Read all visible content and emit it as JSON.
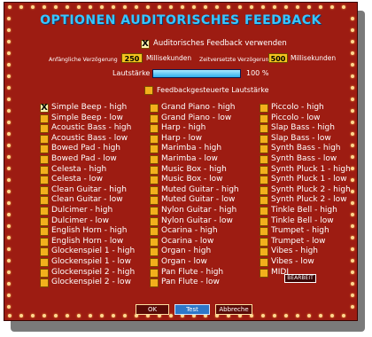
{
  "title": "OPTIONEN AUDITORISCHES FEEDBACK",
  "use_feedback": {
    "label": "Auditorisches Feedback verwenden",
    "checked": true
  },
  "initial_delay": {
    "label": "Anfängliche Verzögerung",
    "value": "250",
    "unit": "Millisekunden"
  },
  "staggered_delay": {
    "label": "Zeitversetzte Verzögerung",
    "value": "500",
    "unit": "Millisekunden"
  },
  "volume": {
    "label": "Lautstärke",
    "value_text": "100 %",
    "level": 1.0
  },
  "feedback_volume": {
    "label": "Feedbackgesteuerte Lautstärke",
    "checked": false
  },
  "sounds": {
    "col1": [
      {
        "label": "Simple Beep - high",
        "checked": true
      },
      {
        "label": "Simple Beep - low",
        "checked": false
      },
      {
        "label": "Acoustic Bass - high",
        "checked": false
      },
      {
        "label": "Acoustic Bass - low",
        "checked": false
      },
      {
        "label": "Bowed Pad - high",
        "checked": false
      },
      {
        "label": "Bowed Pad - low",
        "checked": false
      },
      {
        "label": "Celesta - high",
        "checked": false
      },
      {
        "label": "Celesta - low",
        "checked": false
      },
      {
        "label": "Clean Guitar - high",
        "checked": false
      },
      {
        "label": "Clean Guitar - low",
        "checked": false
      },
      {
        "label": "Dulcimer - high",
        "checked": false
      },
      {
        "label": "Dulcimer - low",
        "checked": false
      },
      {
        "label": "English Horn - high",
        "checked": false
      },
      {
        "label": "English Horn - low",
        "checked": false
      },
      {
        "label": "Glockenspiel 1 - high",
        "checked": false
      },
      {
        "label": "Glockenspiel 1 - low",
        "checked": false
      },
      {
        "label": "Glockenspiel 2 - high",
        "checked": false
      },
      {
        "label": "Glockenspiel 2 - low",
        "checked": false
      }
    ],
    "col2": [
      {
        "label": "Grand Piano - high",
        "checked": false
      },
      {
        "label": "Grand Piano - low",
        "checked": false
      },
      {
        "label": "Harp - high",
        "checked": false
      },
      {
        "label": "Harp - low",
        "checked": false
      },
      {
        "label": "Marimba - high",
        "checked": false
      },
      {
        "label": "Marimba - low",
        "checked": false
      },
      {
        "label": "Music Box - high",
        "checked": false
      },
      {
        "label": "Music Box - low",
        "checked": false
      },
      {
        "label": "Muted Guitar - high",
        "checked": false
      },
      {
        "label": "Muted Guitar - low",
        "checked": false
      },
      {
        "label": "Nylon Guitar - high",
        "checked": false
      },
      {
        "label": "Nylon Guitar - low",
        "checked": false
      },
      {
        "label": "Ocarina - high",
        "checked": false
      },
      {
        "label": "Ocarina - low",
        "checked": false
      },
      {
        "label": "Organ - high",
        "checked": false
      },
      {
        "label": "Organ - low",
        "checked": false
      },
      {
        "label": "Pan Flute - high",
        "checked": false
      },
      {
        "label": "Pan Flute - low",
        "checked": false
      }
    ],
    "col3": [
      {
        "label": "Piccolo - high",
        "checked": false
      },
      {
        "label": "Piccolo - low",
        "checked": false
      },
      {
        "label": "Slap Bass - high",
        "checked": false
      },
      {
        "label": "Slap Bass - low",
        "checked": false
      },
      {
        "label": "Synth Bass - high",
        "checked": false
      },
      {
        "label": "Synth Bass - low",
        "checked": false
      },
      {
        "label": "Synth Pluck 1 - high",
        "checked": false
      },
      {
        "label": "Synth Pluck 1 - low",
        "checked": false
      },
      {
        "label": "Synth Pluck 2 - high",
        "checked": false
      },
      {
        "label": "Synth Pluck 2 - low",
        "checked": false
      },
      {
        "label": "Tinkle Bell - high",
        "checked": false
      },
      {
        "label": "Tinkle Bell - low",
        "checked": false
      },
      {
        "label": "Trumpet - high",
        "checked": false
      },
      {
        "label": "Trumpet - low",
        "checked": false
      },
      {
        "label": "Vibes - high",
        "checked": false
      },
      {
        "label": "Vibes - low",
        "checked": false
      },
      {
        "label": "MIDI",
        "checked": false
      }
    ]
  },
  "midi_edit_label": "BEARBEIT",
  "buttons": {
    "ok": "OK",
    "test": "Test",
    "cancel": "Abbreche"
  },
  "colors": {
    "panel": "#9d1c12",
    "title": "#38c6ff",
    "checkbox": "#f2b01c",
    "field": "#f3c41e",
    "slider": "#30b0ee"
  }
}
